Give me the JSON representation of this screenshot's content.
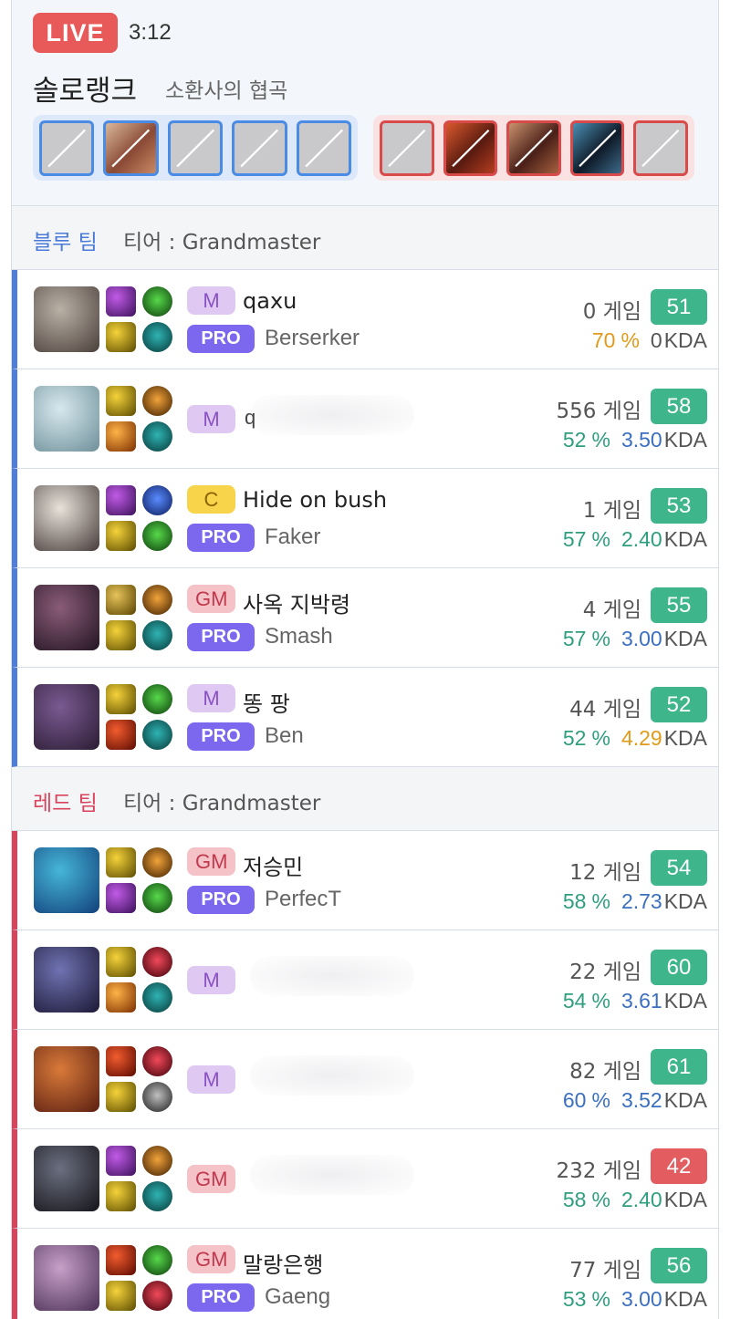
{
  "header": {
    "live_label": "LIVE",
    "timer": "3:12",
    "queue": "솔로랭크",
    "map": "소환사의 협곡",
    "bans_blue": [
      "empty",
      "champ1",
      "empty",
      "empty",
      "empty"
    ],
    "bans_red": [
      "empty",
      "champ2",
      "champ3",
      "champ4",
      "empty"
    ]
  },
  "colors": {
    "blue_team": "#4f7ddb",
    "red_team": "#d9435b",
    "level_green": "#3fb58c",
    "level_red": "#e35d60",
    "pct_green": "#2e9e7e",
    "pct_blue": "#3b6fbf",
    "kda_orange": "#e09b1a"
  },
  "teams": [
    {
      "name": "블루 팀",
      "side": "blue",
      "tier_label": "티어 : Grandmaster",
      "players": [
        {
          "tier": "M",
          "tier_class": "m",
          "summoner": "qaxu",
          "pro": true,
          "pro_label": "PRO",
          "pro_name": "Berserker",
          "games": "0 게임",
          "level": "51",
          "level_color": "green",
          "winrate": "70",
          "winrate_color": "orange",
          "kda": "0",
          "kda_color": "plain",
          "portrait": [
            "#b9b1a6",
            "#4a3f3a"
          ],
          "spells": [
            "purple",
            "yellow"
          ],
          "runes": [
            "green",
            "teal"
          ],
          "blurred": false
        },
        {
          "tier": "M",
          "tier_class": "m",
          "summoner": "q",
          "pro": false,
          "games": "556 게임",
          "level": "58",
          "level_color": "green",
          "winrate": "52",
          "winrate_color": "green",
          "kda": "3.50",
          "kda_color": "blue",
          "portrait": [
            "#d7e8ee",
            "#6d8f99"
          ],
          "spells": [
            "yellow",
            "orange"
          ],
          "runes": [
            "orange",
            "teal"
          ],
          "blurred": true
        },
        {
          "tier": "C",
          "tier_class": "c",
          "summoner": "Hide on bush",
          "pro": true,
          "pro_label": "PRO",
          "pro_name": "Faker",
          "games": "1 게임",
          "level": "53",
          "level_color": "green",
          "winrate": "57",
          "winrate_color": "green",
          "kda": "2.40",
          "kda_color": "green",
          "portrait": [
            "#e8e2da",
            "#463b39"
          ],
          "spells": [
            "purple",
            "yellow"
          ],
          "runes": [
            "blue",
            "green"
          ],
          "blurred": false
        },
        {
          "tier": "GM",
          "tier_class": "gm",
          "summoner": "사옥 지박령",
          "pro": true,
          "pro_label": "PRO",
          "pro_name": "Smash",
          "games": "4 게임",
          "level": "55",
          "level_color": "green",
          "winrate": "57",
          "winrate_color": "green",
          "kda": "3.00",
          "kda_color": "blue",
          "portrait": [
            "#8a5c77",
            "#221423"
          ],
          "spells": [
            "gold",
            "yellow"
          ],
          "runes": [
            "orange",
            "teal"
          ],
          "blurred": false
        },
        {
          "tier": "M",
          "tier_class": "m",
          "summoner": "똥 팡",
          "pro": true,
          "pro_label": "PRO",
          "pro_name": "Ben",
          "games": "44 게임",
          "level": "52",
          "level_color": "green",
          "winrate": "52",
          "winrate_color": "green",
          "kda": "4.29",
          "kda_color": "orange",
          "portrait": [
            "#7a5a92",
            "#2a1c32"
          ],
          "spells": [
            "yellow",
            "red"
          ],
          "runes": [
            "green",
            "teal"
          ],
          "blurred": false
        }
      ]
    },
    {
      "name": "레드 팀",
      "side": "red",
      "tier_label": "티어 : Grandmaster",
      "players": [
        {
          "tier": "GM",
          "tier_class": "gm",
          "summoner": "저승민",
          "pro": true,
          "pro_label": "PRO",
          "pro_name": "PerfecT",
          "games": "12 게임",
          "level": "54",
          "level_color": "green",
          "winrate": "58",
          "winrate_color": "green",
          "kda": "2.73",
          "kda_color": "blue",
          "portrait": [
            "#46b6d8",
            "#11407a"
          ],
          "spells": [
            "yellow",
            "purple"
          ],
          "runes": [
            "orange",
            "green"
          ],
          "blurred": false
        },
        {
          "tier": "M",
          "tier_class": "m",
          "summoner": "",
          "pro": false,
          "games": "22 게임",
          "level": "60",
          "level_color": "green",
          "winrate": "54",
          "winrate_color": "green",
          "kda": "3.61",
          "kda_color": "blue",
          "portrait": [
            "#6f73b2",
            "#1b1734"
          ],
          "spells": [
            "yellow",
            "orange"
          ],
          "runes": [
            "red",
            "teal"
          ],
          "blurred": true
        },
        {
          "tier": "M",
          "tier_class": "m",
          "summoner": "",
          "pro": false,
          "games": "82 게임",
          "level": "61",
          "level_color": "green",
          "winrate": "60",
          "winrate_color": "blue",
          "kda": "3.52",
          "kda_color": "blue",
          "portrait": [
            "#d97a3a",
            "#5a1e10"
          ],
          "spells": [
            "red",
            "yellow"
          ],
          "runes": [
            "red",
            "dark"
          ],
          "blurred": true
        },
        {
          "tier": "GM",
          "tier_class": "gm",
          "summoner": "",
          "pro": false,
          "games": "232 게임",
          "level": "42",
          "level_color": "red",
          "winrate": "58",
          "winrate_color": "green",
          "kda": "2.40",
          "kda_color": "green",
          "portrait": [
            "#6b6f80",
            "#141318"
          ],
          "spells": [
            "purple",
            "yellow"
          ],
          "runes": [
            "orange",
            "teal"
          ],
          "blurred": true
        },
        {
          "tier": "GM",
          "tier_class": "gm",
          "summoner": "말랑은행",
          "pro": true,
          "pro_label": "PRO",
          "pro_name": "Gaeng",
          "games": "77 게임",
          "level": "56",
          "level_color": "green",
          "winrate": "53",
          "winrate_color": "green",
          "kda": "3.00",
          "kda_color": "blue",
          "portrait": [
            "#c7a0c8",
            "#4a2f55"
          ],
          "spells": [
            "red",
            "yellow"
          ],
          "runes": [
            "green",
            "red"
          ],
          "blurred": false
        }
      ]
    }
  ],
  "labels": {
    "percent": "%",
    "kda": "KDA"
  }
}
